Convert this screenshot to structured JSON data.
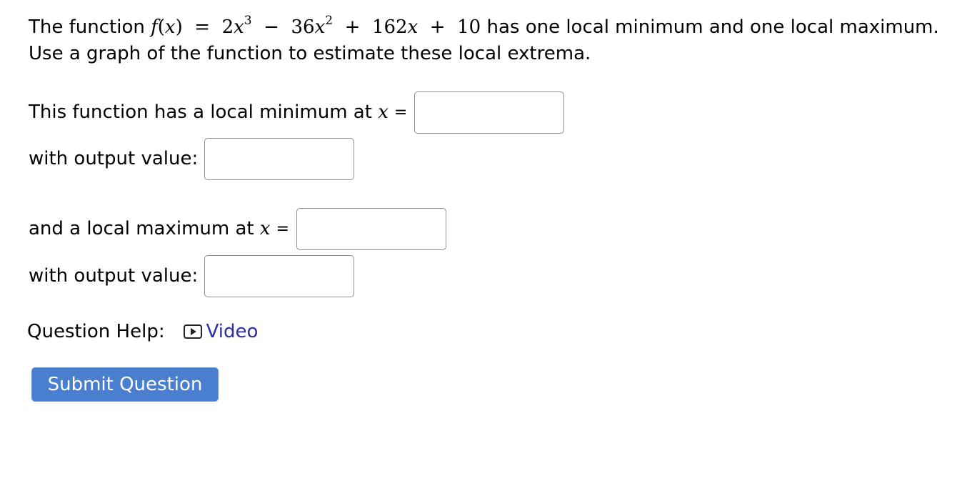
{
  "question": {
    "intro": "The function ",
    "fname": "f",
    "fvar": "x",
    "equals": "=",
    "term1_coef": "2",
    "term1_var": "x",
    "term1_exp": "3",
    "minus": "−",
    "term2_coef": "36",
    "term2_var": "x",
    "term2_exp": "2",
    "plus1": "+",
    "term3_coef": "162",
    "term3_var": "x",
    "plus2": "+",
    "const": "10",
    "rest_line1": " has one local minimum and one local maximum.",
    "line2": "Use a graph of the function to estimate these local extrema."
  },
  "min_x": {
    "label": "This function has a local minimum at ",
    "var": "x",
    "eq": "=",
    "value": ""
  },
  "min_out": {
    "label": "with output value: ",
    "value": ""
  },
  "max_x": {
    "label": "and a local maximum at ",
    "var": "x",
    "eq": "=",
    "value": ""
  },
  "max_out": {
    "label": "with output value: ",
    "value": ""
  },
  "help": {
    "label": "Question Help:",
    "video_label": "Video"
  },
  "submit": {
    "label": "Submit Question"
  }
}
